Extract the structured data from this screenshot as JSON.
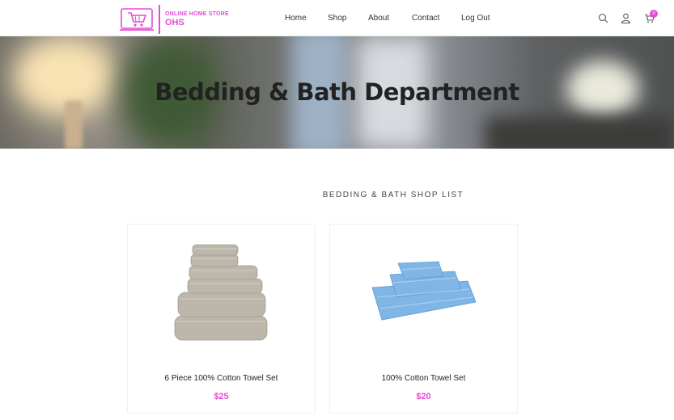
{
  "header": {
    "logo": {
      "line1": "ONLINE HOME STORE",
      "line2": "OHS",
      "icon": "shopping-cart-laptop-icon"
    },
    "nav": [
      "Home",
      "Shop",
      "About",
      "Contact",
      "Log Out"
    ],
    "icons": [
      "search-icon",
      "user-icon",
      "cart-icon"
    ],
    "cart_count": "0"
  },
  "hero": {
    "title": "Bedding & Bath Department"
  },
  "shop": {
    "title": "BEDDING & BATH SHOP LIST",
    "products": [
      {
        "name": "6 Piece 100% Cotton Towel Set",
        "price": "$25",
        "image": "beige-towel-stack"
      },
      {
        "name": "100% Cotton Towel Set",
        "price": "$20",
        "image": "blue-towel-stack"
      }
    ]
  },
  "colors": {
    "accent": "#e74bd6",
    "towel_beige": "#bdb6aa",
    "towel_blue": "#7fb6e6"
  }
}
